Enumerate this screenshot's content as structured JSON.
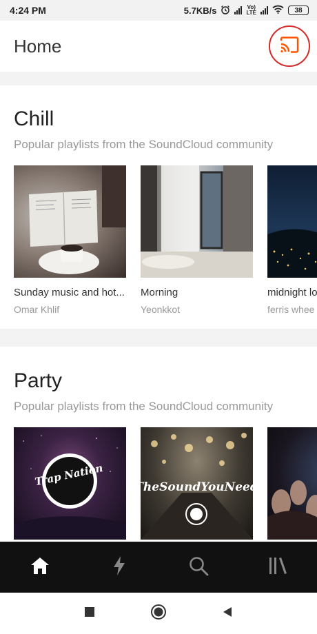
{
  "status_bar": {
    "time": "4:24 PM",
    "speed": "5.7KB/s",
    "volte_top": "Vo)",
    "volte_bottom": "LTE",
    "battery": "38"
  },
  "header": {
    "title": "Home",
    "cast_icon": "cast-icon",
    "accent_color": "#ff5500",
    "highlight_color": "#d42a2a"
  },
  "sections": [
    {
      "title": "Chill",
      "subtitle": "Popular playlists from the SoundCloud community",
      "items": [
        {
          "title": "Sunday music and hot...",
          "subtitle": "Omar Khlif"
        },
        {
          "title": "Morning",
          "subtitle": "Yeonkkot"
        },
        {
          "title": "midnight lo",
          "subtitle": "ferris whee"
        }
      ]
    },
    {
      "title": "Party",
      "subtitle": "Popular playlists from the SoundCloud community",
      "items": [
        {
          "art_text": "Trap Nation"
        },
        {
          "art_text": "TheSoundYouNeed"
        },
        {
          "art_text": ""
        }
      ]
    }
  ],
  "bottom_nav": {
    "items": [
      {
        "icon": "home-icon",
        "active": true
      },
      {
        "icon": "stream-icon",
        "active": false
      },
      {
        "icon": "search-icon",
        "active": false
      },
      {
        "icon": "library-icon",
        "active": false
      }
    ]
  },
  "system_nav": [
    "recents-icon",
    "home-circle-icon",
    "back-icon"
  ]
}
